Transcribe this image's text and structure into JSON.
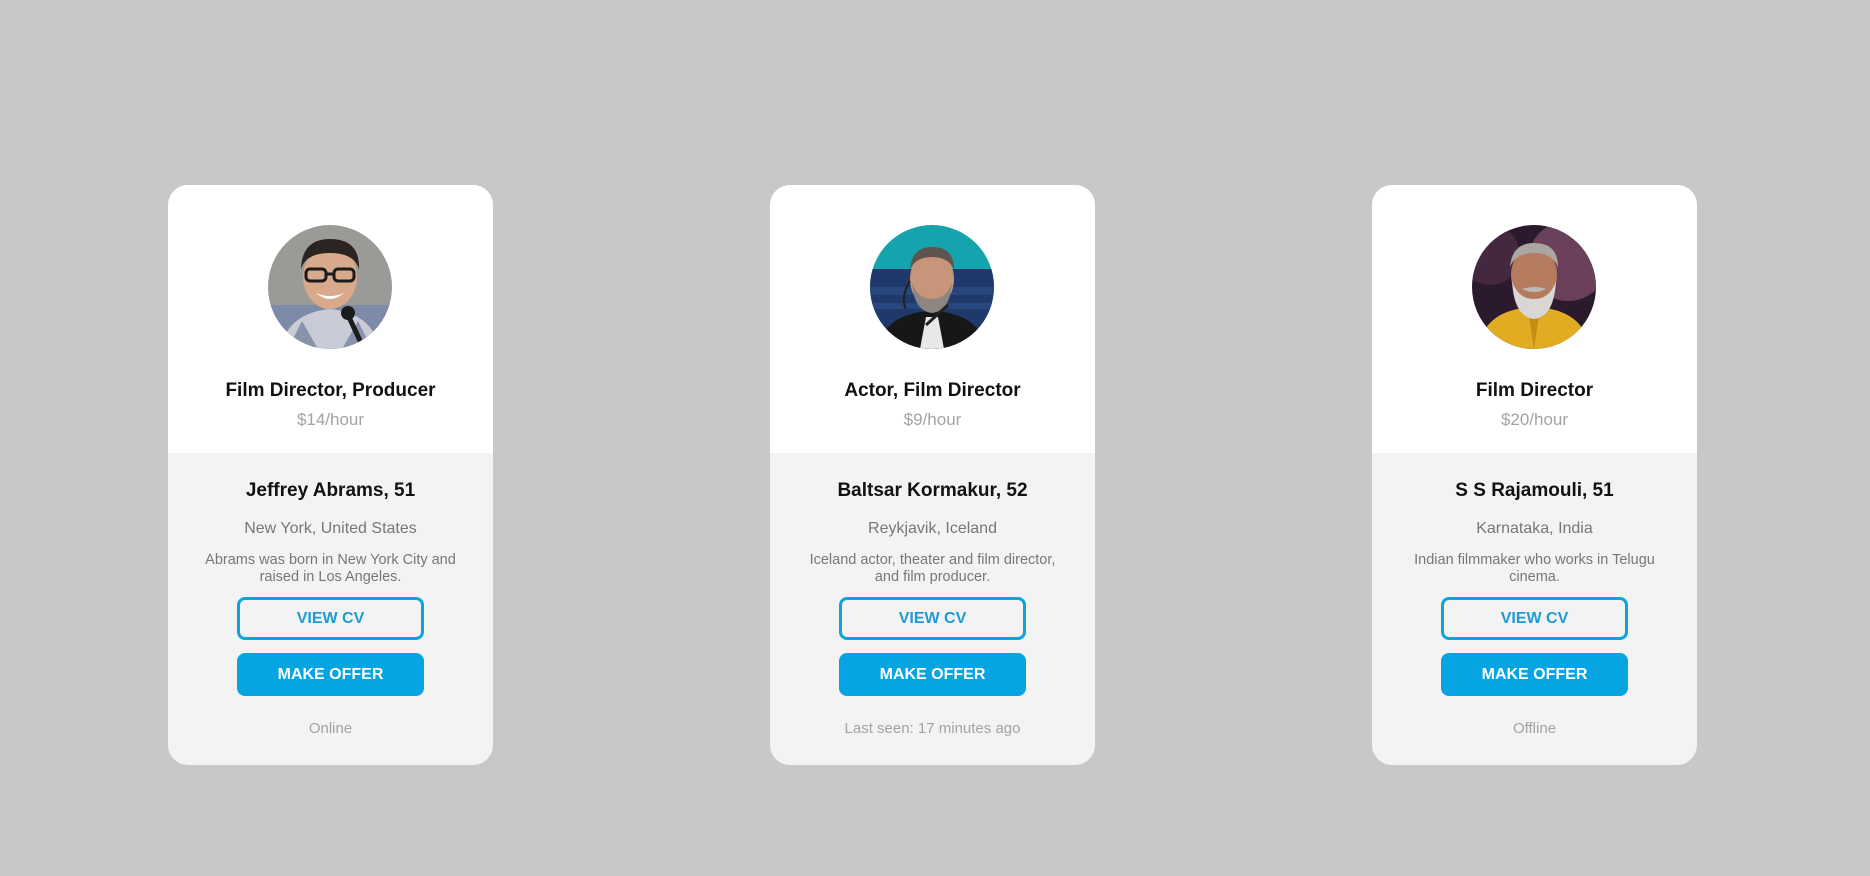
{
  "cards": [
    {
      "role": "Film Director, Producer",
      "rate": "$14/hour",
      "name": "Jeffrey Abrams, 51",
      "location": "New York, United States",
      "bio": "Abrams was born in New York City and raised in Los Angeles.",
      "view_cv_label": "VIEW CV",
      "make_offer_label": "MAKE OFFER",
      "status": "Online",
      "avatar": "avatar-jeffrey-abrams"
    },
    {
      "role": "Actor, Film Director",
      "rate": "$9/hour",
      "name": "Baltsar Kormakur, 52",
      "location": "Reykjavik, Iceland",
      "bio": "Iceland actor, theater and film director, and film producer.",
      "view_cv_label": "VIEW CV",
      "make_offer_label": "MAKE OFFER",
      "status": "Last seen: 17 minutes ago",
      "avatar": "avatar-baltsar-kormakur"
    },
    {
      "role": "Film Director",
      "rate": "$20/hour",
      "name": "S S Rajamouli, 51",
      "location": "Karnataka, India",
      "bio": "Indian filmmaker who works in Telugu cinema.",
      "view_cv_label": "VIEW CV",
      "make_offer_label": "MAKE OFFER",
      "status": "Offline",
      "avatar": "avatar-ss-rajamouli"
    }
  ],
  "colors": {
    "page_background": "#c8c8c8",
    "accent": "#06a4e3",
    "card_top": "#ffffff",
    "card_bottom": "#f3f3f3"
  }
}
